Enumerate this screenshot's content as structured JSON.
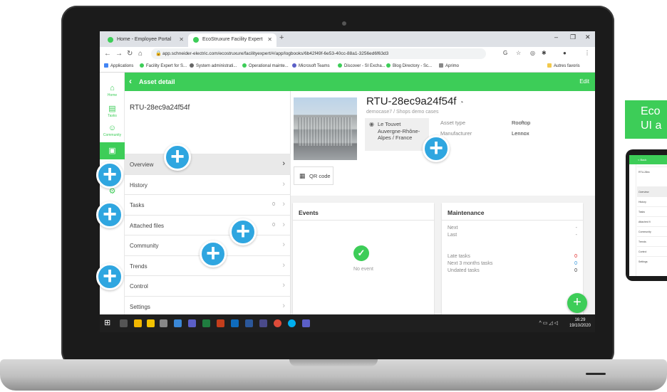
{
  "browser": {
    "tabs": [
      {
        "label": "Home - Employee Portal",
        "active": false
      },
      {
        "label": "EcoStruxure Facility Expert",
        "active": true
      }
    ],
    "new_tab": "+",
    "url": "app.schneider-electric.com/ecostruxure/facilityexpert/#/app/logbooks/6b42f49f-6e53-40cc-88a1-3256ed6f63d3",
    "bookmarks": [
      "Applications",
      "Facility Expert for S...",
      "System administrati...",
      "Operational mainte...",
      "Microsoft Teams",
      "Discover - SI Excha...",
      "Blog Directory - Sc...",
      "Aprimo",
      "Autres favoris"
    ]
  },
  "app": {
    "brand_color": "#3dcd58",
    "nav_rail": [
      {
        "label": "Home",
        "icon": "home-icon"
      },
      {
        "label": "Tasks",
        "icon": "clipboard-icon"
      },
      {
        "label": "Community",
        "icon": "people-icon"
      },
      {
        "label": "",
        "icon": "asset-icon"
      },
      {
        "label": "",
        "icon": "report-icon"
      },
      {
        "label": "",
        "icon": "settings-icon"
      }
    ],
    "header": {
      "title": "Asset detail",
      "edit_label": "Edit"
    },
    "asset_name": "RTU-28ec9a24f54f",
    "menu": [
      {
        "label": "Overview",
        "count": "",
        "selected": true
      },
      {
        "label": "History",
        "count": "",
        "selected": false
      },
      {
        "label": "Tasks",
        "count": "0",
        "selected": false
      },
      {
        "label": "Attached files",
        "count": "0",
        "selected": false
      },
      {
        "label": "Community",
        "count": "",
        "selected": false
      },
      {
        "label": "Trends",
        "count": "",
        "selected": false
      },
      {
        "label": "Control",
        "count": "",
        "selected": false
      },
      {
        "label": "Settings",
        "count": "",
        "selected": false
      }
    ],
    "detail": {
      "title": "RTU-28ec9a24f54f",
      "subtitle": "democase7 / Shops demo cases",
      "location": [
        "Le Touvet",
        "Auvergne-Rhône-",
        "Alpes / France"
      ],
      "asset_type_label": "Asset type",
      "asset_type_value": "Rooftop",
      "manufacturer_label": "Manufacturer",
      "manufacturer_value": "Lennox",
      "qr_label": "QR code"
    },
    "events": {
      "title": "Events",
      "empty_text": "No event"
    },
    "maintenance": {
      "title": "Maintenance",
      "rows": [
        {
          "label": "Next",
          "value": "-"
        },
        {
          "label": "Last",
          "value": "-"
        },
        {
          "label": "Late tasks",
          "value": "0",
          "color": "#e02020"
        },
        {
          "label": "Next 3 months tasks",
          "value": "0",
          "color": "#2a8fd8"
        },
        {
          "label": "Undated tasks",
          "value": "0",
          "color": "#333333"
        }
      ]
    },
    "fab_label": "+"
  },
  "taskbar": {
    "time": "16:29",
    "date": "19/10/2020"
  },
  "hotspot_color": "#2fa6e0",
  "teaser": {
    "line1": "Eco",
    "line2": "UI a"
  },
  "phone": {
    "header": "< Back",
    "rows": [
      "RTU-28ec",
      "Overview",
      "History",
      "Tasks",
      "Attached fi",
      "Community",
      "Trends",
      "Control",
      "Settings"
    ]
  }
}
